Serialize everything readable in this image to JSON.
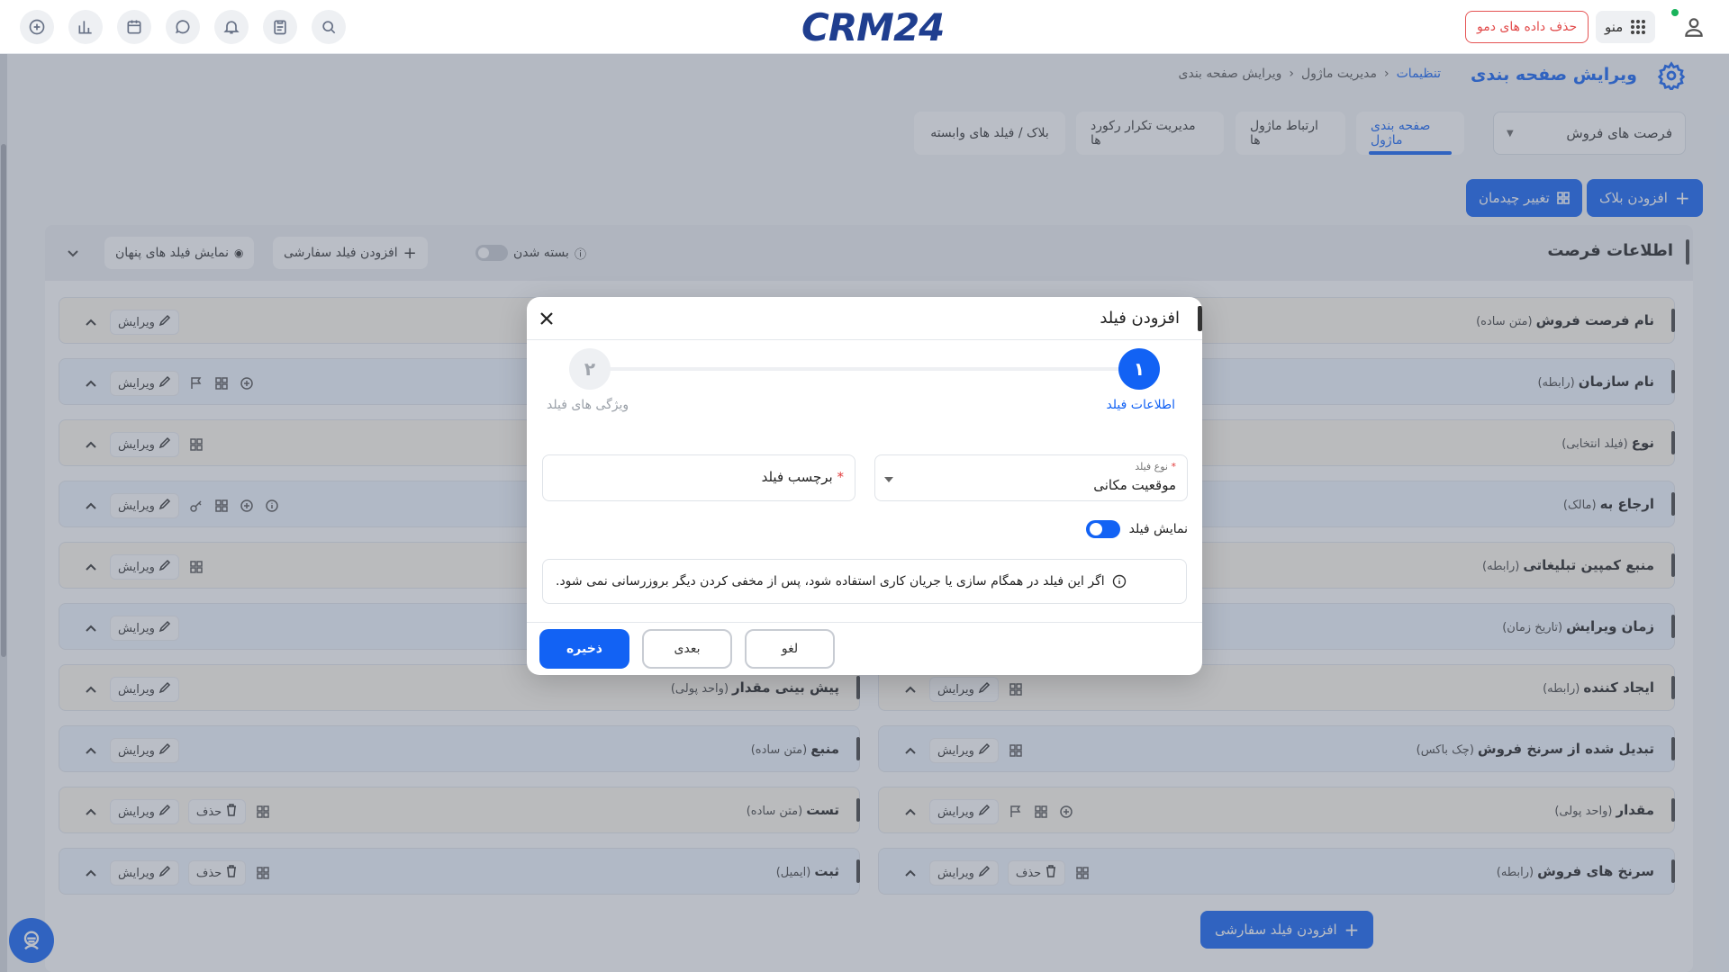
{
  "topbar": {
    "logo": "CRM24",
    "menu_label": "منو",
    "delete_demo_label": "حذف داده های دمو",
    "icons": [
      "plus-circle-icon",
      "chart-icon",
      "calendar-icon",
      "chat-icon",
      "bell-icon",
      "clipboard-icon",
      "search-icon"
    ]
  },
  "header": {
    "title": "ویرایش صفحه بندی",
    "breadcrumb": [
      "تنظیمات",
      "مدیریت ماژول",
      "ویرایش صفحه بندی"
    ]
  },
  "module_select": "فرصت های فروش",
  "tabs": [
    {
      "label": "صفحه بندی ماژول",
      "active": true
    },
    {
      "label": "ارتباط ماژول ها"
    },
    {
      "label": "مدیریت تکرار رکورد ها"
    },
    {
      "label": "بلاک / فیلد های وابسته"
    }
  ],
  "actions": {
    "add_block": "افزودن بلاک",
    "change_layout": "تغییر چیدمان"
  },
  "section": {
    "title": "اطلاعات فرصت",
    "collapse_label": "بسته شدن",
    "add_custom_field": "افزودن فیلد سفارشی",
    "show_hidden": "نمایش فیلد های پنهان"
  },
  "edit_label": "ویرایش",
  "delete_label": "حذف",
  "right_fields": [
    {
      "name": "نام فرصت فروش",
      "type": "(متن ساده)"
    },
    {
      "name": "نام سازمان",
      "type": "(رابطه)"
    },
    {
      "name": "نوع",
      "type": "(فیلد انتخابی)"
    },
    {
      "name": "ارجاع به",
      "type": "(مالک)"
    },
    {
      "name": "منبع کمپین تبلیغاتی",
      "type": "(رابطه)"
    },
    {
      "name": "زمان ویرایش",
      "type": "(تاریخ زمان)"
    },
    {
      "name": "ایجاد کننده",
      "type": "(رابطه)"
    },
    {
      "name": "تبدیل شده از سرنخ فروش",
      "type": "(چک باکس)"
    },
    {
      "name": "مقدار",
      "type": "(واحد پولی)"
    },
    {
      "name": "سرنخ های فروش",
      "type": "(رابطه)"
    }
  ],
  "left_fields": [
    {
      "name": "پیش بینی مقدار",
      "type": "(واحد پولی)"
    },
    {
      "name": "منبع",
      "type": "(متن ساده)"
    },
    {
      "name": "تست",
      "type": "(متن ساده)"
    },
    {
      "name": "ثبت",
      "type": "(ایمیل)"
    }
  ],
  "bottom_add_custom": "افزودن فیلد سفارشی",
  "modal": {
    "title": "افزودن فیلد",
    "step1_number": "۱",
    "step1_label": "اطلاعات فیلد",
    "step2_number": "۲",
    "step2_label": "ویژگی های فیلد",
    "field_type_label": "نوع فیلد",
    "field_type_value": "موقعیت مکانی",
    "field_label_label": "برچسب فیلد",
    "required_mark": "*",
    "show_field_label": "نمایش فیلد",
    "show_field_on": true,
    "notice": "اگر این فیلد در همگام سازی یا جریان کاری استفاده شود، پس از مخفی کردن دیگر بروزرسانی نمی شود.",
    "cancel": "لغو",
    "next": "بعدی",
    "save": "ذخیره"
  },
  "colors": {
    "accent": "#1262f4",
    "danger": "#e24b4b"
  }
}
